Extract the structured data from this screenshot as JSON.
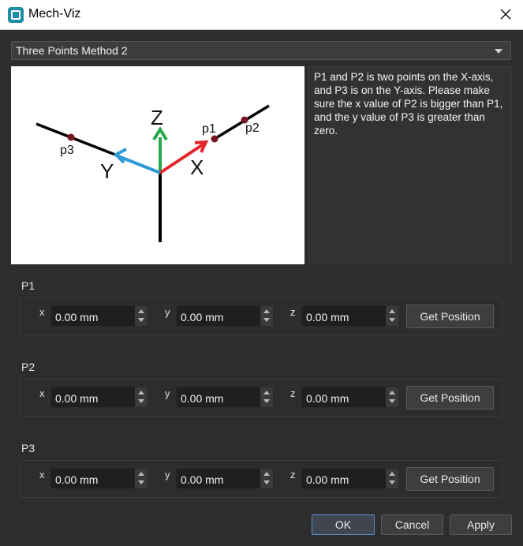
{
  "window": {
    "title": "Mech-Viz",
    "close_glyph": "✕"
  },
  "method": {
    "selected": "Three Points Method 2"
  },
  "diagram": {
    "label_z": "Z",
    "label_x": "X",
    "label_y": "Y",
    "label_p1": "p1",
    "label_p2": "p2",
    "label_p3": "p3",
    "colors": {
      "x_axis": "#e3262b",
      "y_axis": "#2e9bd6",
      "z_axis": "#25a84a",
      "point": "#7a1620",
      "line": "#000000"
    }
  },
  "description": "P1 and P2 is two points on the X-axis, and P3 is on the Y-axis. Please make sure the x value of P2 is bigger than P1, and the y value of P3 is greater than zero.",
  "points": [
    {
      "label": "P1",
      "x_label": "x",
      "y_label": "y",
      "z_label": "z",
      "x": "0.00 mm",
      "y": "0.00 mm",
      "z": "0.00 mm",
      "get_position": "Get Position"
    },
    {
      "label": "P2",
      "x_label": "x",
      "y_label": "y",
      "z_label": "z",
      "x": "0.00 mm",
      "y": "0.00 mm",
      "z": "0.00 mm",
      "get_position": "Get Position"
    },
    {
      "label": "P3",
      "x_label": "x",
      "y_label": "y",
      "z_label": "z",
      "x": "0.00 mm",
      "y": "0.00 mm",
      "z": "0.00 mm",
      "get_position": "Get Position"
    }
  ],
  "footer": {
    "ok": "OK",
    "cancel": "Cancel",
    "apply": "Apply"
  }
}
